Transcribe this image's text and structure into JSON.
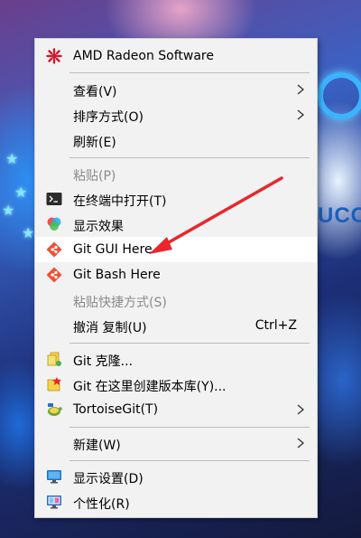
{
  "menu": {
    "items": [
      {
        "label": "AMD Radeon Software",
        "icon": "amd-radeon-icon"
      },
      {
        "label": "查看(V)",
        "submenu": true
      },
      {
        "label": "排序方式(O)",
        "submenu": true
      },
      {
        "label": "刷新(E)"
      },
      {
        "label": "粘贴(P)",
        "disabled": true
      },
      {
        "label": "在终端中打开(T)",
        "icon": "terminal-icon"
      },
      {
        "label": "显示效果",
        "icon": "color-effects-icon"
      },
      {
        "label": "Git GUI Here",
        "icon": "git-icon",
        "highlighted": true
      },
      {
        "label": "Git Bash Here",
        "icon": "git-icon"
      },
      {
        "label": "粘贴快捷方式(S)",
        "disabled": true
      },
      {
        "label": "撤消 复制(U)",
        "shortcut": "Ctrl+Z"
      },
      {
        "label": "Git 克隆...",
        "icon": "tortoisegit-clone-icon"
      },
      {
        "label": "Git 在这里创建版本库(Y)...",
        "icon": "tortoisegit-create-repo-icon"
      },
      {
        "label": "TortoiseGit(T)",
        "icon": "tortoisegit-icon",
        "submenu": true
      },
      {
        "label": "新建(W)",
        "submenu": true
      },
      {
        "label": "显示设置(D)",
        "icon": "display-settings-icon"
      },
      {
        "label": "个性化(R)",
        "icon": "personalize-icon"
      }
    ]
  },
  "colors": {
    "menu_bg": "#f2f2f2",
    "highlight_bg": "#ffffff",
    "disabled_text": "#8a8a8a",
    "annotation_arrow": "#e8262c"
  },
  "wallpaper": {
    "visible_text": "UCC"
  }
}
